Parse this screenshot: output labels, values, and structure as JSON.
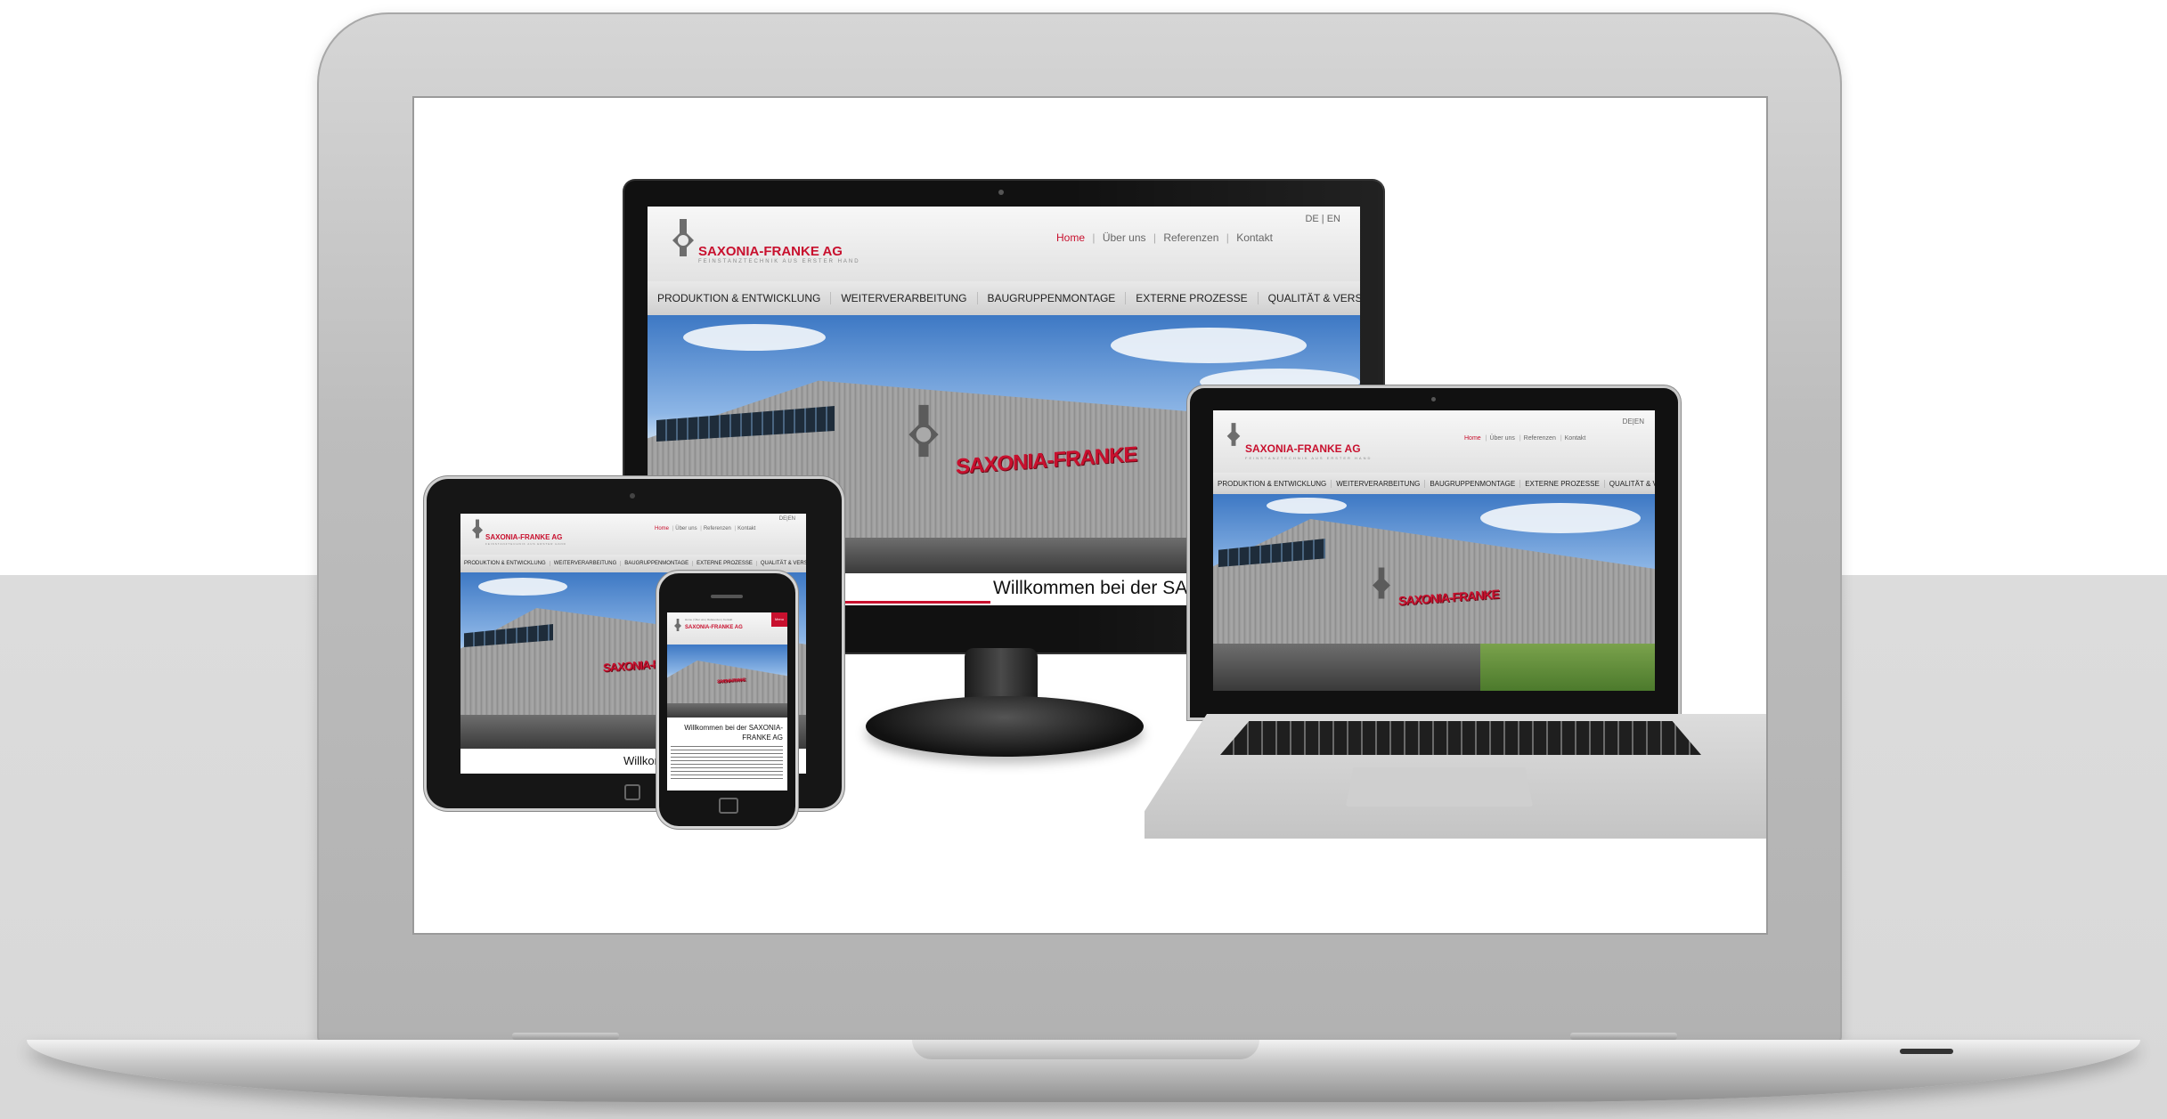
{
  "brand": {
    "name": "SAXONIA-FRANKE AG",
    "tagline": "FEINSTANZTECHNIK AUS ERSTER HAND",
    "building_sign": "SAXONIA-FRANKE"
  },
  "lang": {
    "de": "DE",
    "sep": "|",
    "en": "EN"
  },
  "top_nav": [
    {
      "label": "Home",
      "active": true
    },
    {
      "label": "Über uns",
      "active": false
    },
    {
      "label": "Referenzen",
      "active": false
    },
    {
      "label": "Kontakt",
      "active": false
    }
  ],
  "main_nav": [
    "PRODUKTION & ENTWICKLUNG",
    "WEITERVERARBEITUNG",
    "BAUGRUPPENMONTAGE",
    "EXTERNE PROZESSE",
    "QUALITÄT & VERSAND"
  ],
  "monitor": {
    "welcome_visible": "Willkommen bei der SA"
  },
  "tablet": {
    "welcome_visible": "Willkom"
  },
  "phone": {
    "nav_mini": "Home | Über uns | Referenzen | Kontakt",
    "menu_label": "Menu",
    "welcome": "Willkommen bei der SAXONIA-FRANKE AG"
  },
  "colors": {
    "brand_red": "#c8102e",
    "body_gray": "#dcdcdc"
  }
}
